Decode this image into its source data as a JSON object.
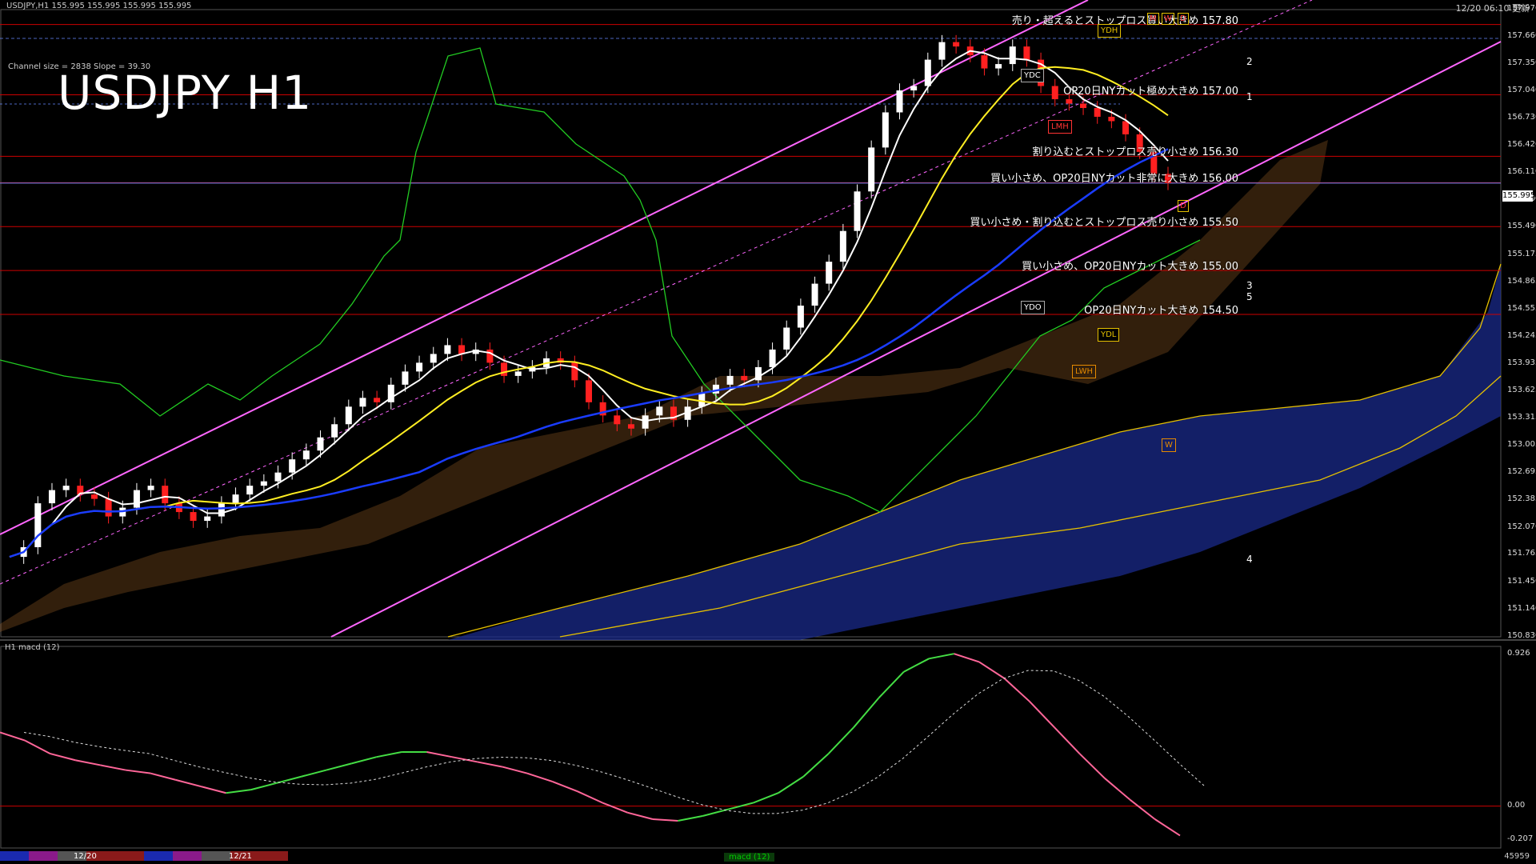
{
  "header": {
    "symbol_line": "USDJPY,H1  155.995 155.995 155.995 155.995",
    "timestamp": "12/20 06:10 更新",
    "channel_info": "Channel size = 2838 Slope = 39.30",
    "big_title": "USDJPY H1",
    "subwindow_title": "H1  macd (12)"
  },
  "annotations": [
    {
      "text": "売り・超えるとストップロス買い大きめ 157.80",
      "price": 157.8
    },
    {
      "text": "OP20日NYカット極め大きめ 157.00",
      "price": 157.0
    },
    {
      "text": "割り込むとストップロス売り小さめ 156.30",
      "price": 156.3
    },
    {
      "text": "買い小さめ、OP20日NYカット非常に大きめ 156.00",
      "price": 156.0
    },
    {
      "text": "買い小さめ・割り込むとストップロス売り小さめ 155.50",
      "price": 155.5
    },
    {
      "text": "買い小さめ、OP20日NYカット大きめ 155.00",
      "price": 155.0
    },
    {
      "text": "OP20日NYカット大きめ 154.50",
      "price": 154.5
    }
  ],
  "boxes": {
    "ydc": "YDC",
    "ydh": "YDH",
    "ydo": "YDO",
    "ydl": "YDL",
    "lwh": "LWH",
    "lmh": "LMH",
    "w": "W",
    "m": "M",
    "w2": "W",
    "d": "D",
    "d2": "D"
  },
  "fibo_labels": [
    "2",
    "1",
    "3",
    "5",
    "4"
  ],
  "current_price": "155.995",
  "price_ticks": [
    "157.970",
    "157.660",
    "157.350",
    "157.040",
    "156.730",
    "156.420",
    "156.110",
    "155.800",
    "155.490",
    "155.175",
    "154.865",
    "154.555",
    "154.245",
    "153.935",
    "153.625",
    "153.315",
    "153.005",
    "152.695",
    "152.385",
    "152.070",
    "151.765",
    "151.450",
    "151.140",
    "150.830"
  ],
  "macd_ticks": [
    "0.926",
    "0.00",
    "-0.207"
  ],
  "footer": {
    "date1": "12/20",
    "date2": "12/21",
    "macd_tag": "macd (12)",
    "right": "45959"
  },
  "colors": {
    "background": "#000000",
    "candle_up": "#ffffff",
    "candle_down": "#ff2020",
    "ma_white": "#ffffff",
    "ma_yellow": "#ffee22",
    "ma_blue": "#1a3cff",
    "channel": "#ff66ff",
    "chikou": "#22cc22",
    "h_lines": "#cc0000",
    "cloud_blue": "#1a2a8a",
    "cloud_orange": "#c87a30",
    "macd_up": "#44dd44",
    "macd_down": "#ff6699"
  },
  "chart_data": {
    "type": "line",
    "title": "USDJPY H1",
    "ylim": [
      150.83,
      157.97
    ],
    "horizontal_levels": [
      157.8,
      157.0,
      156.3,
      156.0,
      155.5,
      155.0,
      154.5
    ],
    "close_series": [
      151.74,
      151.85,
      152.35,
      152.5,
      152.55,
      152.45,
      152.4,
      152.2,
      152.3,
      152.5,
      152.55,
      152.35,
      152.25,
      152.15,
      152.2,
      152.35,
      152.45,
      152.55,
      152.6,
      152.7,
      152.85,
      152.95,
      153.1,
      153.25,
      153.45,
      153.55,
      153.5,
      153.7,
      153.85,
      153.95,
      154.05,
      154.15,
      154.05,
      154.1,
      153.95,
      153.8,
      153.85,
      153.9,
      154.0,
      153.95,
      153.75,
      153.5,
      153.35,
      153.25,
      153.2,
      153.35,
      153.45,
      153.3,
      153.45,
      153.6,
      153.7,
      153.8,
      153.75,
      153.9,
      154.1,
      154.35,
      154.6,
      154.85,
      155.1,
      155.45,
      155.9,
      156.4,
      156.8,
      157.05,
      157.1,
      157.4,
      157.6,
      157.55,
      157.45,
      157.3,
      157.35,
      157.55,
      157.4,
      157.1,
      156.95,
      156.9,
      156.85,
      156.75,
      156.7,
      156.55,
      156.35,
      156.1,
      155.995
    ],
    "macd_series": [
      0.45,
      0.4,
      0.32,
      0.28,
      0.25,
      0.22,
      0.2,
      0.16,
      0.12,
      0.08,
      0.1,
      0.14,
      0.18,
      0.22,
      0.26,
      0.3,
      0.33,
      0.33,
      0.3,
      0.27,
      0.24,
      0.2,
      0.15,
      0.09,
      0.02,
      -0.04,
      -0.08,
      -0.09,
      -0.06,
      -0.02,
      0.02,
      0.08,
      0.18,
      0.32,
      0.48,
      0.66,
      0.82,
      0.9,
      0.93,
      0.88,
      0.78,
      0.64,
      0.48,
      0.32,
      0.17,
      0.04,
      -0.08,
      -0.18
    ],
    "macd_ylim": [
      -0.207,
      0.926
    ]
  }
}
